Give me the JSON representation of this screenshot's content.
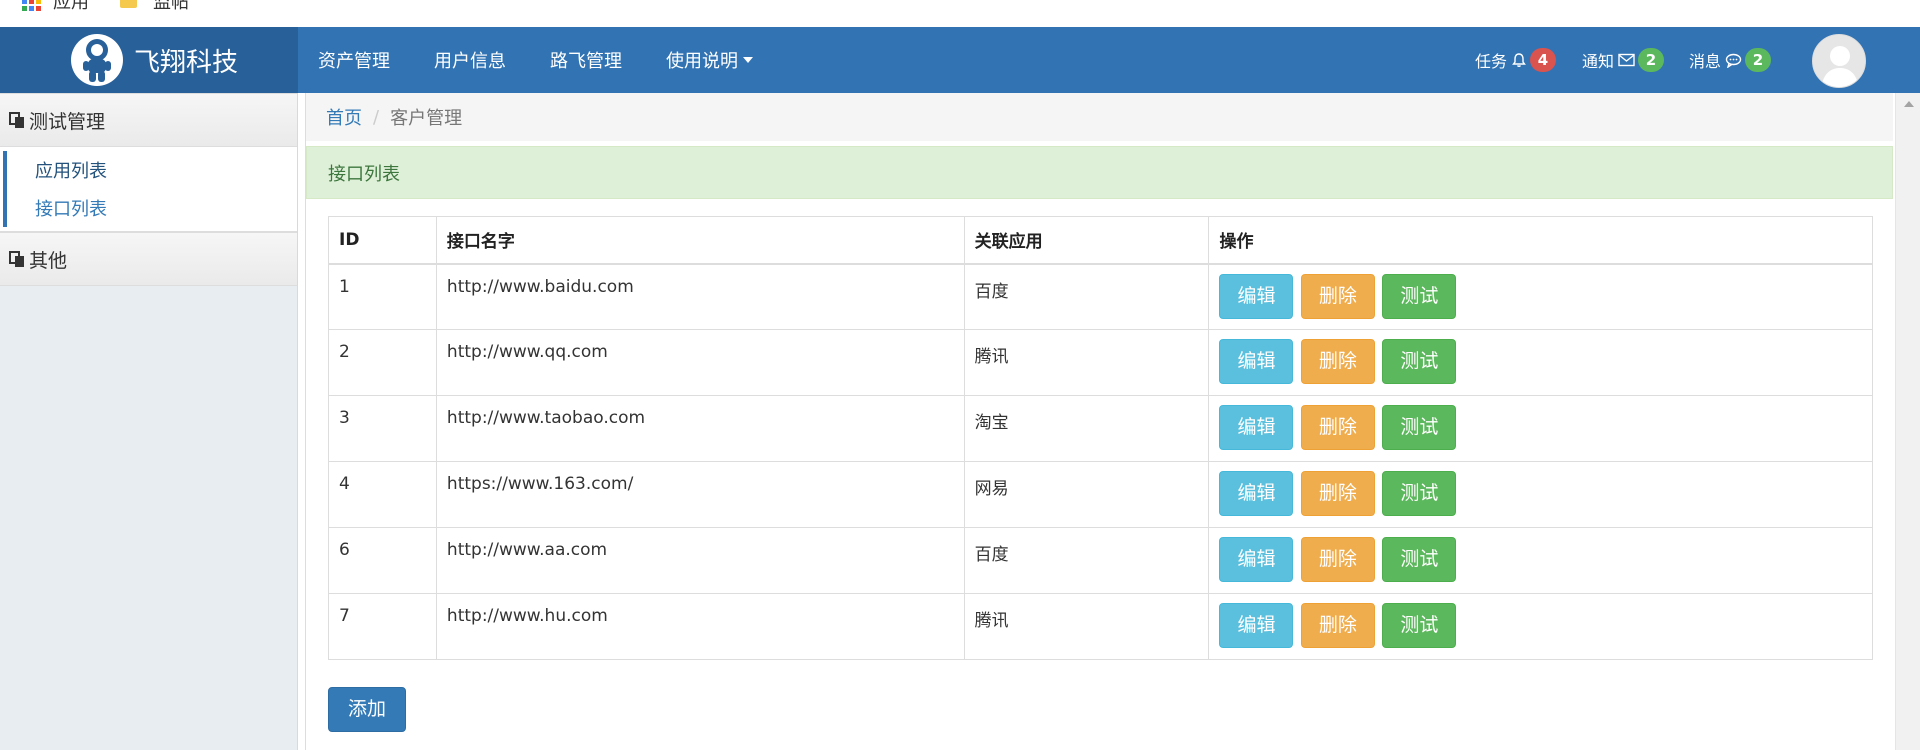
{
  "bookmarks": {
    "apps_label": "应用",
    "folder_label": "监帖",
    "apps_icon": "apps-grid-icon",
    "folder_icon": "folder-icon"
  },
  "navbar": {
    "brand": "飞翔科技",
    "logo_icon": "astronaut-logo-icon",
    "links": [
      "资产管理",
      "用户信息",
      "路飞管理",
      "使用说明"
    ],
    "tasks": {
      "label": "任务",
      "icon": "bell-icon",
      "count": "4"
    },
    "notices": {
      "label": "通知",
      "icon": "envelope-icon",
      "count": "2"
    },
    "messages": {
      "label": "消息",
      "icon": "comment-icon",
      "count": "2"
    },
    "avatar_icon": "user-avatar-icon",
    "colors": {
      "bar": "#3273b3",
      "brand_bg": "#28609a"
    }
  },
  "sidebar": {
    "groups": [
      {
        "title": "测试管理",
        "icon": "copy-icon",
        "items": [
          "应用列表",
          "接口列表"
        ]
      },
      {
        "title": "其他",
        "icon": "copy-icon",
        "items": []
      }
    ]
  },
  "main": {
    "breadcrumb": {
      "home": "首页",
      "current": "客户管理"
    },
    "panel_title": "接口列表",
    "table": {
      "headers": [
        "ID",
        "接口名字",
        "关联应用",
        "操作"
      ],
      "rows": [
        {
          "id": "1",
          "name": "http://www.baidu.com",
          "app": "百度"
        },
        {
          "id": "2",
          "name": "http://www.qq.com",
          "app": "腾讯"
        },
        {
          "id": "3",
          "name": "http://www.taobao.com",
          "app": "淘宝"
        },
        {
          "id": "4",
          "name": "https://www.163.com/",
          "app": "网易"
        },
        {
          "id": "6",
          "name": "http://www.aa.com",
          "app": "百度"
        },
        {
          "id": "7",
          "name": "http://www.hu.com",
          "app": "腾讯"
        }
      ],
      "actions": {
        "edit": "编辑",
        "delete": "删除",
        "test": "测试"
      }
    },
    "add_button": "添加"
  }
}
